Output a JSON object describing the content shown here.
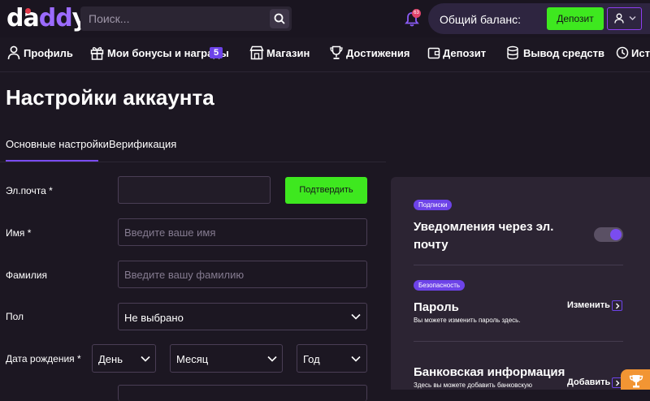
{
  "header": {
    "logo": {
      "pre": "da",
      "highlight": "dd",
      "post": "y"
    },
    "search_placeholder": "Поиск...",
    "notif_badge": "63",
    "balance_label": "Общий баланс:",
    "deposit_label": "Депозит"
  },
  "nav": [
    {
      "label": "Профиль",
      "icon": "user-icon"
    },
    {
      "label": "Мои бонусы и награды",
      "icon": "gift-icon",
      "badge": "5"
    },
    {
      "label": "Магазин",
      "icon": "store-icon"
    },
    {
      "label": "Достижения",
      "icon": "trophy-icon"
    },
    {
      "label": "Депозит",
      "icon": "wallet-icon"
    },
    {
      "label": "Вывод средств",
      "icon": "coins-icon"
    },
    {
      "label": "Ист",
      "icon": "history-icon"
    }
  ],
  "page_title": "Настройки аккаунта",
  "tabs": [
    {
      "label": "Основные настройки",
      "active": true
    },
    {
      "label": "Верификация",
      "active": false
    }
  ],
  "form": {
    "email_label": "Эл.почта *",
    "email_value": "",
    "confirm_label": "Подтвердить",
    "name_label": "Имя *",
    "name_placeholder": "Введите ваше имя",
    "surname_label": "Фамилия",
    "surname_placeholder": "Введите вашу фамилию",
    "gender_label": "Пол",
    "gender_value": "Не выбрано",
    "dob_label": "Дата рождения *",
    "day_value": "День",
    "month_value": "Месяц",
    "year_value": "Год"
  },
  "side_card": {
    "subs_pill": "Подписки",
    "email_notif_title": "Уведомления через эл. почту",
    "email_notif_enabled": true,
    "security_pill": "Безопасность",
    "password_title": "Пароль",
    "password_sub": "Вы можете изменить пароль здесь.",
    "password_action": "Изменить",
    "bank_title": "Банковская информация",
    "bank_sub": "Здесь вы можете добавить банковскую",
    "bank_action": "Добавить"
  },
  "colors": {
    "accent_green": "#3ee81f",
    "accent_purple": "#7a4cf0",
    "background": "#1c1722",
    "card": "#2c2433",
    "trophy_orange": "#f29533"
  }
}
